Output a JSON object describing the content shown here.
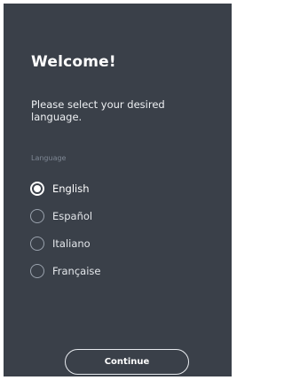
{
  "colors": {
    "panel_background": "#3a4049",
    "page_background": "#ffffff",
    "text_primary": "#ffffff",
    "text_muted": "#7e8794",
    "radio_border": "#9aa2ad"
  },
  "header": {
    "title": "Welcome!",
    "subtitle": "Please select your desired language."
  },
  "language": {
    "section_label": "Language",
    "selected": "English",
    "options": [
      {
        "label": "English",
        "selected": true
      },
      {
        "label": "Español",
        "selected": false
      },
      {
        "label": "Italiano",
        "selected": false
      },
      {
        "label": "Française",
        "selected": false
      }
    ]
  },
  "footer": {
    "continue_label": "Continue"
  }
}
